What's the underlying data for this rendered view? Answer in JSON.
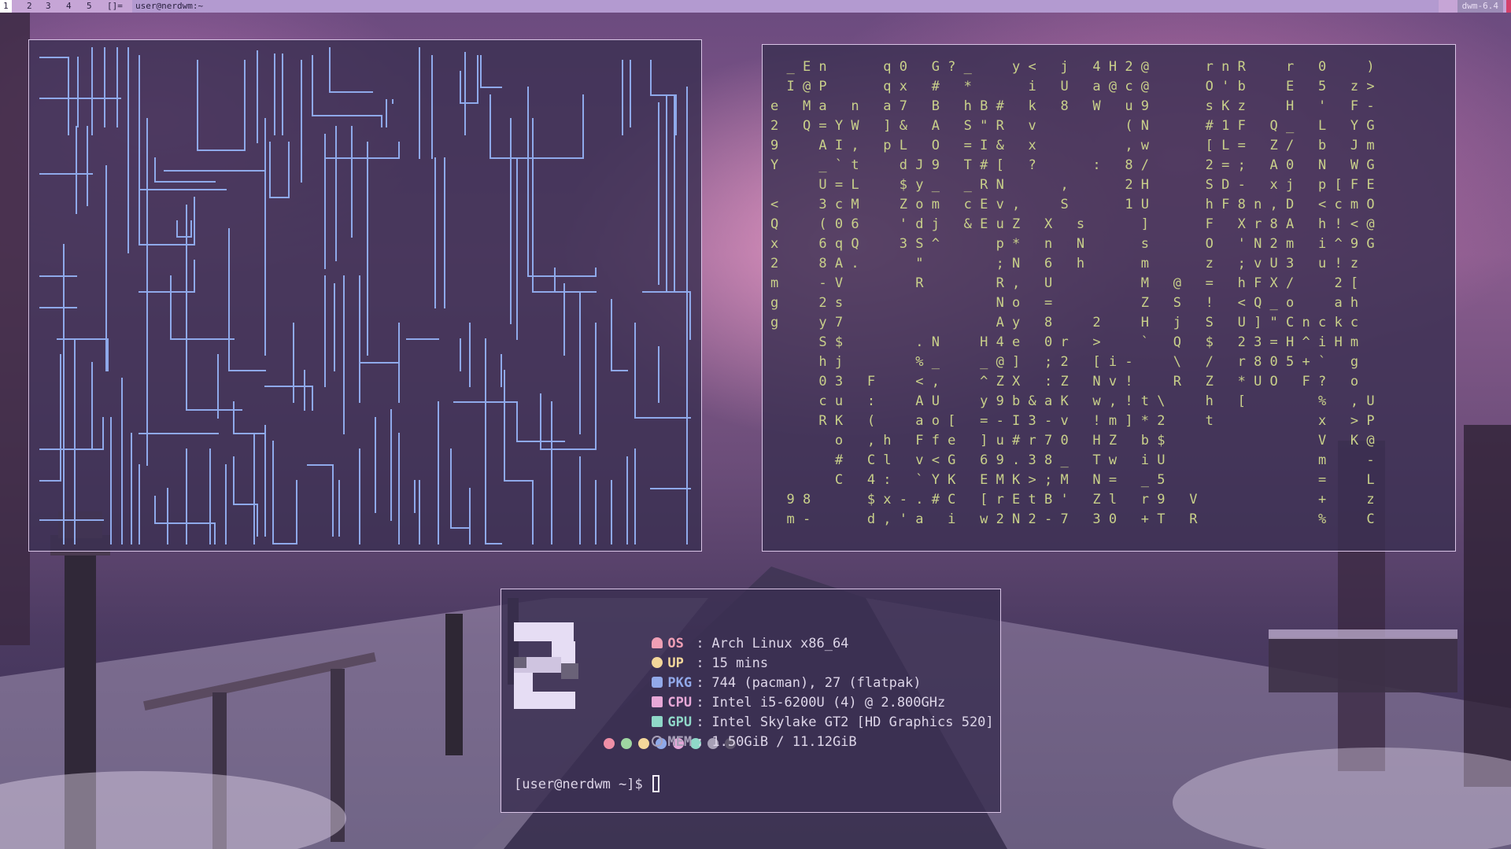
{
  "bar": {
    "tags": [
      "1",
      "2",
      "3",
      "4",
      "5"
    ],
    "active_tag": "1",
    "layout": "[]=",
    "window_title": "user@nerdwm:~",
    "status": "dwm-6.4"
  },
  "matrix_lines": [
    "  _ E n       q 0   G ? _     y <   j   4 H 2 @       r n R     r   0     )",
    "  I @ P       q x   #   *       i   U   a @ c @       O ' b     E   5   z >",
    "e   M a   n   a 7   B   h B #   k   8   W   u 9       s K z     H   '   F -",
    "2   Q = Y W   ] &   A   S \" R   v           ( N       # 1 F   Q _   L   Y G",
    "9     A I ,   p L   O   = I &   x           , w       [ L =   Z /   b   J m",
    "Y     _ ` t     d J 9   T # [   ?       :   8 /       2 = ;   A 0   N   W G",
    "      U = L     $ y _   _ R N       ,       2 H       S D -   x j   p [ F E",
    "<     3 c M     Z o m   c E v ,     S       1 U       h F 8 n , D   < c m O",
    "Q     ( 0 6     ' d j   & E u Z   X   s       ]       F   X r 8 A   h ! < @",
    "x     6 q Q     3 S ^       p *   n   N       s       O   ' N 2 m   i ^ 9 G",
    "2     8 A .       \"         ; N   6   h       m       z   ; v U 3   u ! z",
    "m     - V         R         R ,   U           M   @   =   h F X /     2 [",
    "g     2 s                   N o   =           Z   S   !   < Q _ o     a h",
    "g     y 7                   A y   8     2     H   j   S   U ] \" C n c k c",
    "      S $         . N     H 4 e   0 r   >     `   Q   $   2 3 = H ^ i H m",
    "      h j         % _     _ @ ]   ; 2   [ i -     \\   /   r 8 0 5 + `   g",
    "      0 3   F     < ,     ^ Z X   : Z   N v !     R   Z   * U O   F ?   o",
    "      c u   :     A U     y 9 b & a K   w , ! t \\     h   [         %   , U",
    "      R K   (     a o [   = - I 3 - v   ! m ] * 2     t             x   > P",
    "        o   , h   F f e   ] u # r 7 0   H Z   b $                   V   K @",
    "        #   C l   v < G   6 9 . 3 8 _   T w   i U                   m     -",
    "        C   4 :   ` Y K   E M K > ; M   N =   _ 5                   =     L",
    "  9 8       $ x - . # C   [ r E t B '   Z l   r 9   V               +     z",
    "  m -       d , ' a   i   w 2 N 2 - 7   3 0   + T   R               %     C"
  ],
  "fetch": {
    "rows": [
      {
        "label": "OS",
        "value": "Arch Linux x86_64",
        "color": "#ef9fb5",
        "icon": "arch-icon"
      },
      {
        "label": "UP",
        "value": "15 mins",
        "color": "#f4d79a",
        "icon": "clock-icon"
      },
      {
        "label": "PKG",
        "value": "744 (pacman), 27 (flatpak)",
        "color": "#92a9ea",
        "icon": "package-icon"
      },
      {
        "label": "CPU",
        "value": "Intel i5-6200U (4) @ 2.800GHz",
        "color": "#e8a7d7",
        "icon": "cpu-icon"
      },
      {
        "label": "GPU",
        "value": "Intel Skylake GT2 [HD Graphics 520]",
        "color": "#8fd8c8",
        "icon": "gpu-icon"
      },
      {
        "label": "MEM",
        "value": "1.50GiB / 11.12GiB",
        "color": "#a8a0b8",
        "icon": "memory-icon"
      }
    ],
    "separator": ":",
    "swatches": [
      "#ef8fa6",
      "#9fd6a2",
      "#f4d79a",
      "#8fa9ea",
      "#e6a7d9",
      "#8fd8c8",
      "#a7a0b6",
      "#5e566c"
    ],
    "prompt": "[user@nerdwm ~]$ "
  },
  "colors": {
    "pipes": "#8fa9ea",
    "matrix": "#c9d08a",
    "bar": "#c6a5d6"
  }
}
